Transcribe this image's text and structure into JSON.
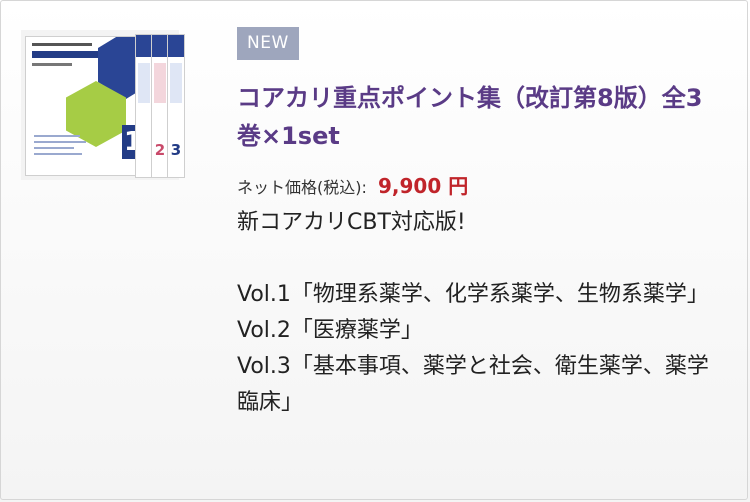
{
  "product": {
    "badge": "NEW",
    "title": "コアカリ重点ポイント集（改訂第8版）全3巻×1set",
    "price_label": "ネット価格(税込):",
    "price_value": "9,900 円",
    "tagline": "新コアカリCBT対応版!",
    "volumes": [
      "Vol.1「物理系薬学、化学系薬学、生物系薬学」",
      "Vol.2「医療薬学」",
      "Vol.3「基本事項、薬学と社会、衛生薬学、薬学臨床」"
    ],
    "image": {
      "volume_numbers": [
        "1",
        "2",
        "3"
      ],
      "colors": {
        "navy": "#2a4595",
        "green": "#a6cc45",
        "pink": "#c94a6a"
      }
    }
  }
}
